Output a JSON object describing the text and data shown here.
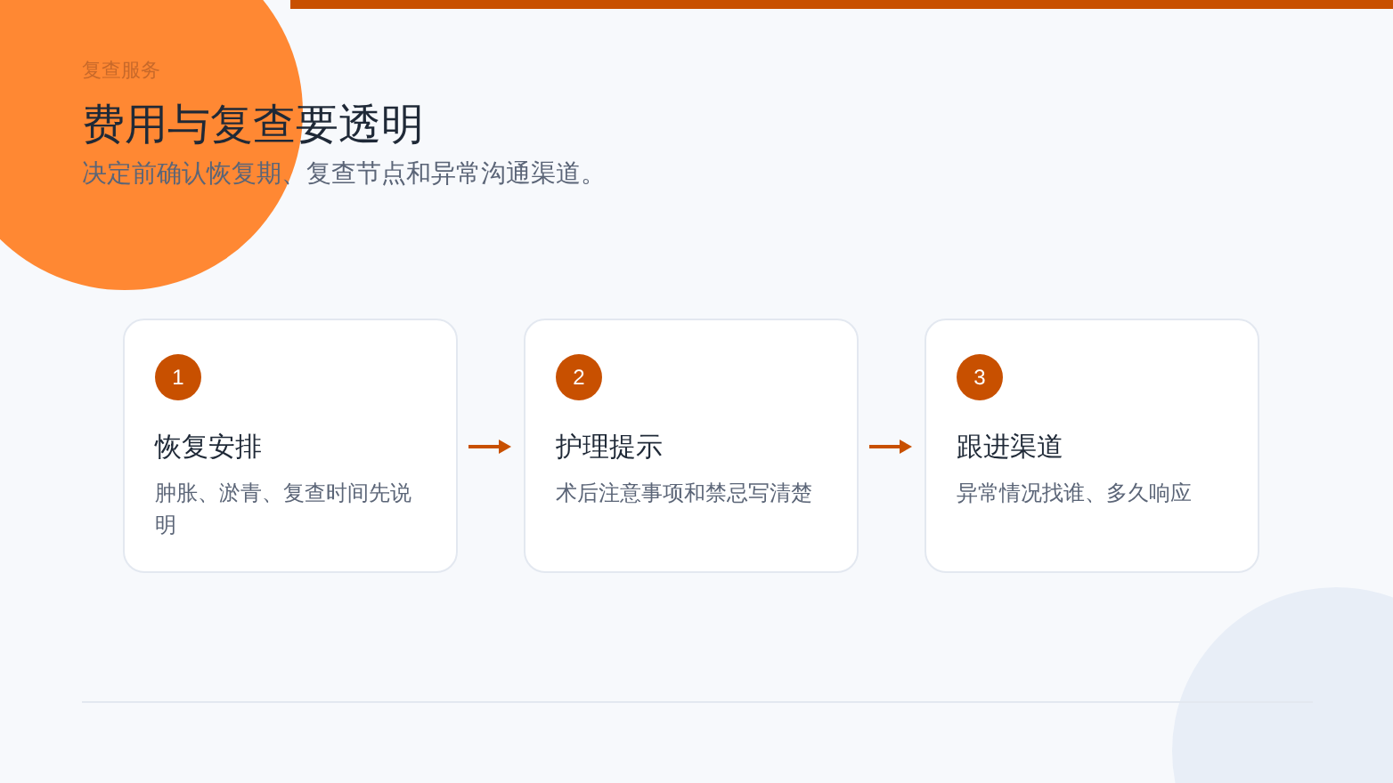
{
  "eyebrow": "复查服务",
  "title": "费用与复查要透明",
  "subtitle": "决定前确认恢复期、复查节点和异常沟通渠道。",
  "steps": [
    {
      "number": "1",
      "title": "恢复安排",
      "description": "肿胀、淤青、复查时间先说明"
    },
    {
      "number": "2",
      "title": "护理提示",
      "description": "术后注意事项和禁忌写清楚"
    },
    {
      "number": "3",
      "title": "跟进渠道",
      "description": "异常情况找谁、多久响应"
    }
  ]
}
